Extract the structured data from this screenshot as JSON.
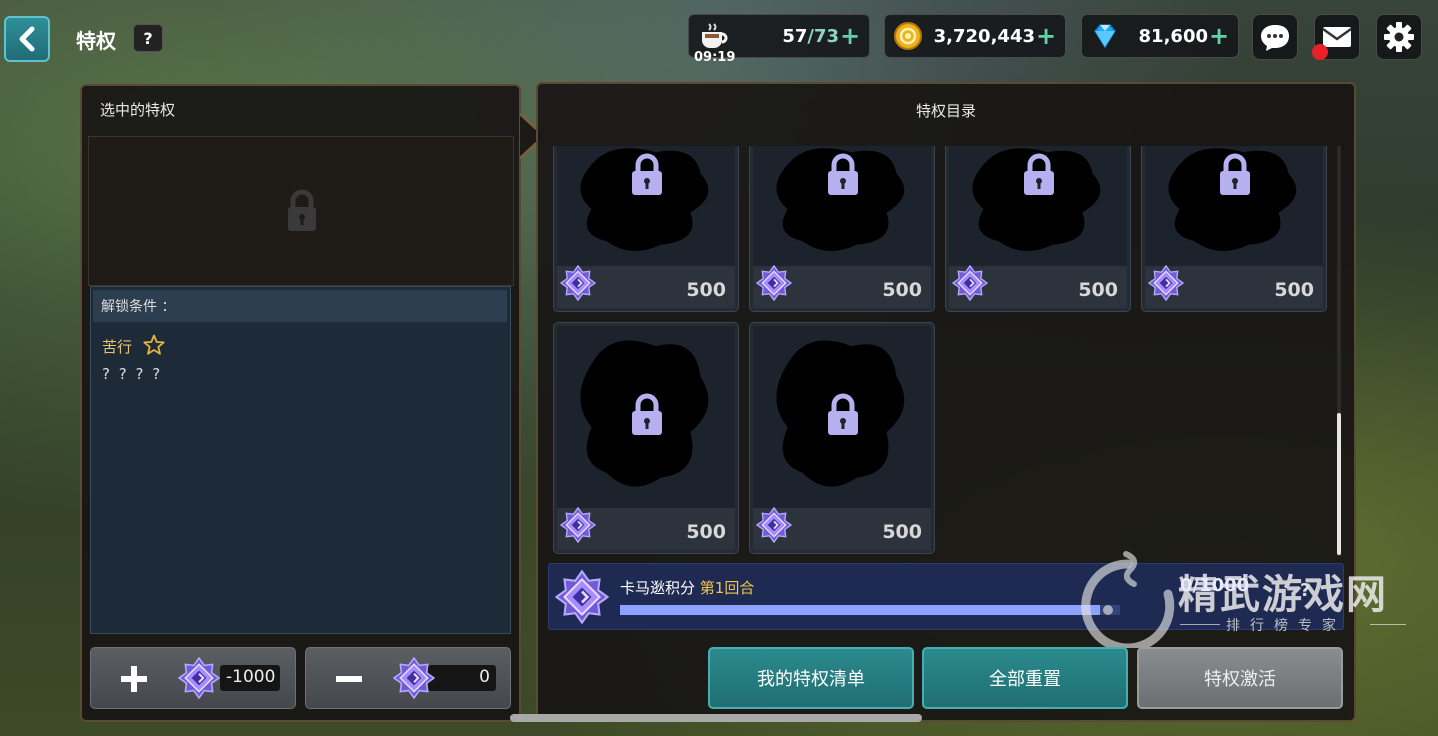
{
  "header": {
    "title": "特权",
    "help_label": "?"
  },
  "resources": {
    "stamina": {
      "current": "57",
      "max": "/73",
      "timer": "09:19",
      "icon": "coffee-cup-icon"
    },
    "gold": {
      "value": "3,720,443",
      "icon": "gold-coin-icon"
    },
    "diamond": {
      "value": "81,600",
      "icon": "diamond-icon"
    },
    "plus_label": "+"
  },
  "left_panel": {
    "title": "选中的特权",
    "unlock_label": "解锁条件 ：",
    "condition_name": "苦行",
    "condition_desc": "? ? ? ?",
    "add_value": "-1000",
    "sub_value": "0"
  },
  "catalog": {
    "title": "特权目录",
    "cards": [
      {
        "cost": "500"
      },
      {
        "cost": "500"
      },
      {
        "cost": "500"
      },
      {
        "cost": "500"
      },
      {
        "cost": "500"
      },
      {
        "cost": "500"
      }
    ]
  },
  "points": {
    "label": "卡马逖积分",
    "round": "第1回合",
    "value": "0/1000",
    "help": "?",
    "progress": 0.96
  },
  "actions": {
    "my_list": "我的特权清单",
    "reset_all": "全部重置",
    "activate": "特权激活"
  },
  "watermark": {
    "main": "精武游戏网",
    "sub": "排行榜专家"
  },
  "colors": {
    "teal_button": "#2b8b8e",
    "gray_button": "#7b7e81",
    "points_bar": "#1e2a52",
    "round_highlight": "#f3c847"
  }
}
